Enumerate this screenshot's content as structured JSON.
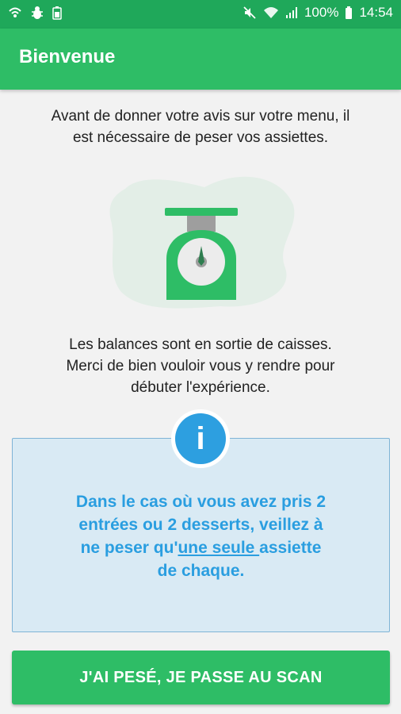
{
  "status_bar": {
    "left_icons": [
      "wifi-hotspot-icon",
      "bug-icon",
      "battery-saver-icon"
    ],
    "right_icons": [
      "mute-icon",
      "wifi-icon",
      "signal-icon"
    ],
    "battery_percent": "100%",
    "time": "14:54"
  },
  "app_bar": {
    "title": "Bienvenue"
  },
  "intro": {
    "line1": "Avant de donner votre avis sur votre menu, il",
    "line2": "est nécessaire de peser vos assiettes."
  },
  "illustration": {
    "name": "kitchen-scale-illustration"
  },
  "location_text": {
    "line1": "Les balances sont en sortie de caisses.",
    "line2": "Merci de bien vouloir vous y rendre pour",
    "line3": "débuter l'expérience."
  },
  "info_box": {
    "badge": "i",
    "line1": "Dans le cas où vous avez pris 2",
    "line2": "entrées ou 2 desserts, veillez à",
    "line3_before": "ne peser qu'",
    "line3_underlined": "une seule ",
    "line3_after": "assiette",
    "line4": "de chaque."
  },
  "cta": {
    "label": "J'AI PESÉ, JE PASSE AU SCAN"
  },
  "colors": {
    "status_bar": "#1fa85a",
    "primary": "#2ebd66",
    "info_blue": "#2d9fe0",
    "info_bg": "#d9eaf4",
    "background": "#f2f2f2"
  }
}
